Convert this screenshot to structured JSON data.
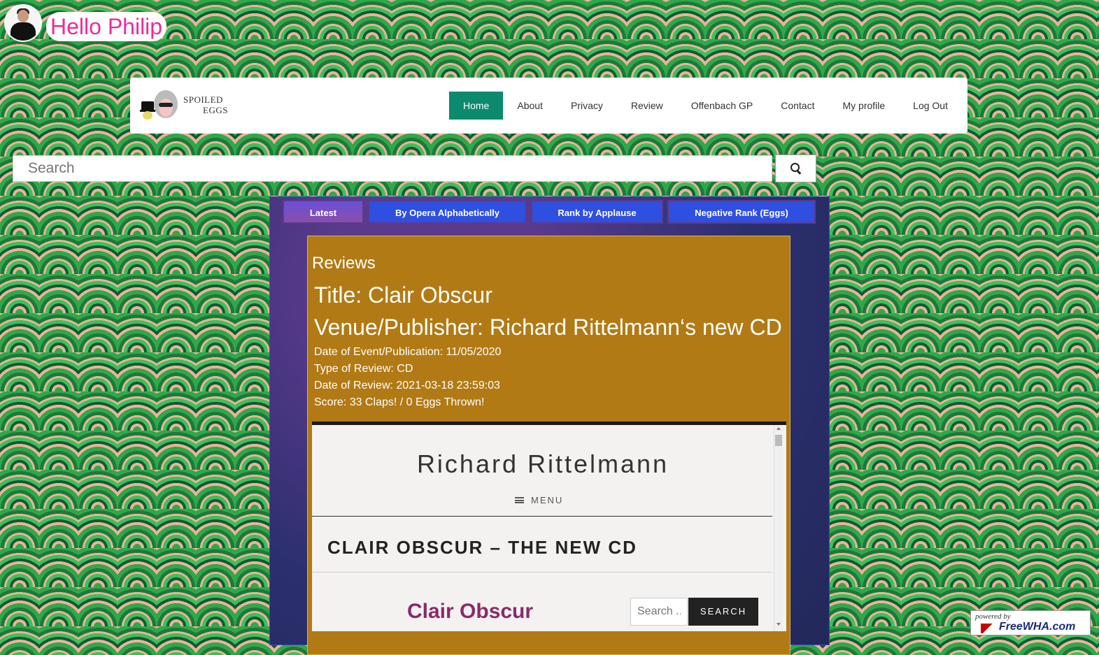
{
  "user": {
    "greeting": "Hello Philip",
    "avatar_icon": "user-avatar"
  },
  "logo": {
    "line1": "SPOILED",
    "line2": "EGGS"
  },
  "nav": {
    "items": [
      {
        "label": "Home",
        "active": true
      },
      {
        "label": "About"
      },
      {
        "label": "Privacy"
      },
      {
        "label": "Review"
      },
      {
        "label": "Offenbach GP"
      },
      {
        "label": "Contact"
      },
      {
        "label": "My profile"
      },
      {
        "label": "Log Out"
      }
    ],
    "active_color": "#0b8a6e"
  },
  "search": {
    "placeholder": "Search",
    "button_icon": "search-icon"
  },
  "tabs": [
    {
      "label": "Latest",
      "active": true
    },
    {
      "label": "By Opera Alphabetically"
    },
    {
      "label": "Rank by Applause"
    },
    {
      "label": "Negative Rank (Eggs)"
    }
  ],
  "review": {
    "heading": "Reviews",
    "title": "Title: Clair Obscur",
    "venue": "Venue/Publisher: Richard Rittelmann‘s new CD",
    "date_event": "Date of Event/Publication: 11/05/2020",
    "type": "Type of Review: CD",
    "date_review": "Date of Review: 2021-03-18 23:59:03",
    "score": "Score: 33 Claps! / 0 Eggs Thrown!",
    "card_color": "#b27a14"
  },
  "embedded": {
    "site_title": "Richard Rittelmann",
    "menu_label": "MENU",
    "post_title": "CLAIR OBSCUR – THE NEW CD",
    "subheading": "Clair Obscur",
    "search_placeholder": "Search ...",
    "search_button": "SEARCH"
  },
  "powered": {
    "line1": "powered by",
    "line2": "FreeWHA.com"
  }
}
